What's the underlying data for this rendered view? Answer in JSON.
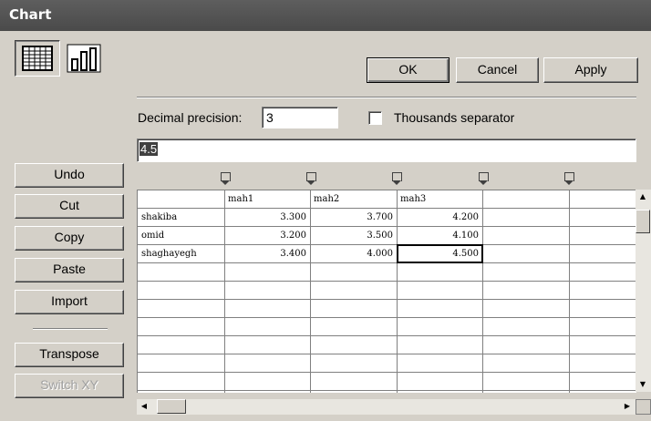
{
  "window": {
    "title": "Chart"
  },
  "toolbar": {
    "ok_label": "OK",
    "cancel_label": "Cancel",
    "apply_label": "Apply",
    "view_datasheet_icon": "datasheet-icon",
    "view_chart_icon": "bar-chart-icon"
  },
  "options": {
    "decimal_precision_label": "Decimal precision:",
    "decimal_precision_value": "3",
    "thousands_separator_label": "Thousands separator",
    "thousands_separator_checked": false
  },
  "edit_field": {
    "value": "4.5"
  },
  "side_buttons": {
    "undo": "Undo",
    "cut": "Cut",
    "copy": "Copy",
    "paste": "Paste",
    "import": "Import",
    "transpose": "Transpose",
    "switch_xy": "Switch XY"
  },
  "grid": {
    "headers": [
      "",
      "mah1",
      "mah2",
      "mah3",
      "",
      ""
    ],
    "rows": [
      {
        "label": "shakiba",
        "values": [
          "3.300",
          "3.700",
          "4.200"
        ]
      },
      {
        "label": "omid",
        "values": [
          "3.200",
          "3.500",
          "4.100"
        ]
      },
      {
        "label": "shaghayegh",
        "values": [
          "3.400",
          "4.000",
          "4.500"
        ]
      }
    ],
    "selected_cell": {
      "row": 2,
      "col": 2
    }
  }
}
